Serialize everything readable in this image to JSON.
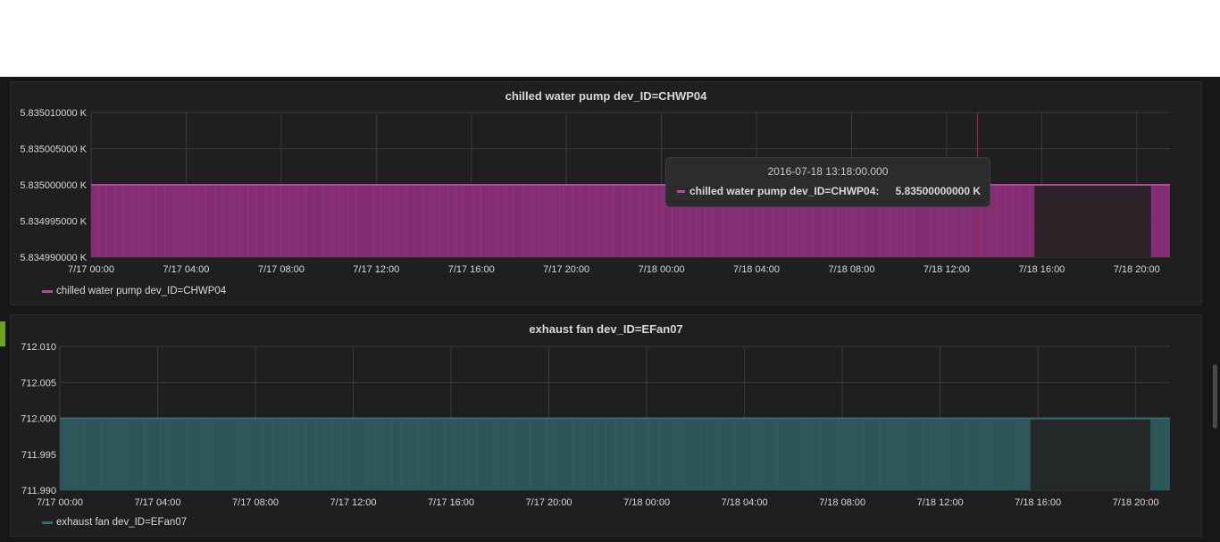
{
  "colors": {
    "pump_series": "#b5479d",
    "pump_fill": "#832d73",
    "fan_series": "#356b6e",
    "fan_fill": "#2d5658",
    "grid": "#3a3a3c",
    "crosshair": "#b0203a"
  },
  "panels": [
    {
      "title": "chilled water pump dev_ID=CHWP04",
      "legend": "chilled water pump dev_ID=CHWP04",
      "tooltip": {
        "time": "2016-07-18 13:18:00.000",
        "series": "chilled water pump dev_ID=CHWP04:",
        "value": "5.83500000000 K"
      }
    },
    {
      "title": "exhaust fan dev_ID=EFan07",
      "legend": "exhaust fan dev_ID=EFan07"
    }
  ],
  "chart_data": [
    {
      "type": "area",
      "title": "chilled water pump dev_ID=CHWP04",
      "x_tick_labels": [
        "7/17 00:00",
        "7/17 04:00",
        "7/17 08:00",
        "7/17 12:00",
        "7/17 16:00",
        "7/17 20:00",
        "7/18 00:00",
        "7/18 04:00",
        "7/18 08:00",
        "7/18 12:00",
        "7/18 16:00",
        "7/18 20:00"
      ],
      "y_tick_labels": [
        "5.835010000 K",
        "5.835005000 K",
        "5.835000000 K",
        "5.834995000 K",
        "5.834990000 K"
      ],
      "x_range_hours": [
        0,
        45.4
      ],
      "ylim": [
        5.83499,
        5.83501
      ],
      "series": [
        {
          "name": "chilled water pump dev_ID=CHWP04",
          "value": 5.835,
          "filled_until_hours": 39.7,
          "resumes_at_hours": 44.6
        }
      ],
      "crosshair_hours": 37.3,
      "grid": true,
      "legend_position": "bottom-left"
    },
    {
      "type": "area",
      "title": "exhaust fan dev_ID=EFan07",
      "x_tick_labels": [
        "7/17 00:00",
        "7/17 04:00",
        "7/17 08:00",
        "7/17 12:00",
        "7/17 16:00",
        "7/17 20:00",
        "7/18 00:00",
        "7/18 04:00",
        "7/18 08:00",
        "7/18 12:00",
        "7/18 16:00",
        "7/18 20:00"
      ],
      "y_tick_labels": [
        "712.010",
        "712.005",
        "712.000",
        "711.995",
        "711.990"
      ],
      "x_range_hours": [
        0,
        45.4
      ],
      "ylim": [
        711.99,
        712.01
      ],
      "series": [
        {
          "name": "exhaust fan dev_ID=EFan07",
          "value": 712.0,
          "filled_until_hours": 39.7,
          "resumes_at_hours": 44.6
        }
      ],
      "grid": true,
      "legend_position": "bottom-left"
    }
  ]
}
